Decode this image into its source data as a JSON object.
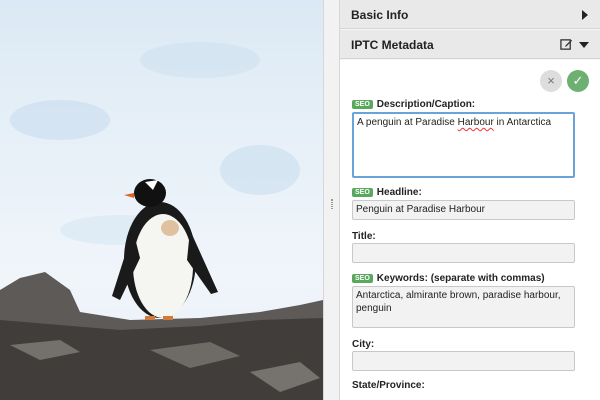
{
  "panel": {
    "basic_info": "Basic Info",
    "iptc_metadata": "IPTC Metadata"
  },
  "actions": {
    "cancel": "×",
    "ok": "✓"
  },
  "seo_badge": "SEO",
  "fields": {
    "description": {
      "label": "Description/Caption:",
      "value_a": "A penguin at Paradise ",
      "value_b": "Harbour",
      "value_c": " in Antarctica"
    },
    "headline": {
      "label": "Headline:",
      "value": "Penguin at Paradise Harbour"
    },
    "title": {
      "label": "Title:",
      "value": ""
    },
    "keywords": {
      "label": "Keywords: (separate with commas)",
      "value": "Antarctica, almirante brown, paradise harbour, penguin"
    },
    "city": {
      "label": "City:",
      "value": ""
    },
    "state": {
      "label": "State/Province:"
    }
  },
  "icons": {
    "edit": "edit-icon",
    "expand": "chevron-right-icon",
    "collapse": "chevron-down-icon"
  }
}
